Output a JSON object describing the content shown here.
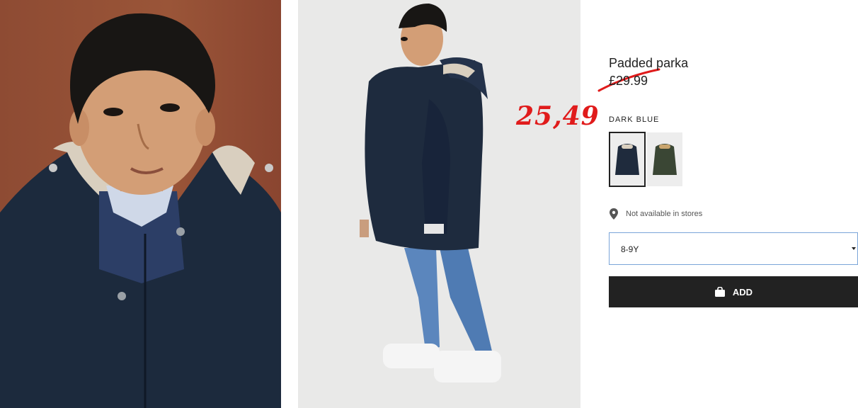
{
  "product": {
    "title": "Padded parka",
    "old_price": "£29.99",
    "sale_price": "25,49",
    "color_label": "DARK BLUE",
    "store_availability": "Not available in stores",
    "size_value": "8-9Y",
    "add_label": "ADD"
  },
  "swatches": [
    {
      "name": "dark-blue",
      "color": "#1f2b3d",
      "selected": true
    },
    {
      "name": "khaki-green",
      "color": "#3a4634",
      "selected": false
    }
  ],
  "icons": {
    "location": "location-pin-icon",
    "bag": "shopping-bag-icon",
    "dropdown": "chevron-down-icon"
  },
  "colors": {
    "sale_price": "#e01b1b",
    "add_button": "#222222",
    "select_border": "#7aa5d8"
  }
}
